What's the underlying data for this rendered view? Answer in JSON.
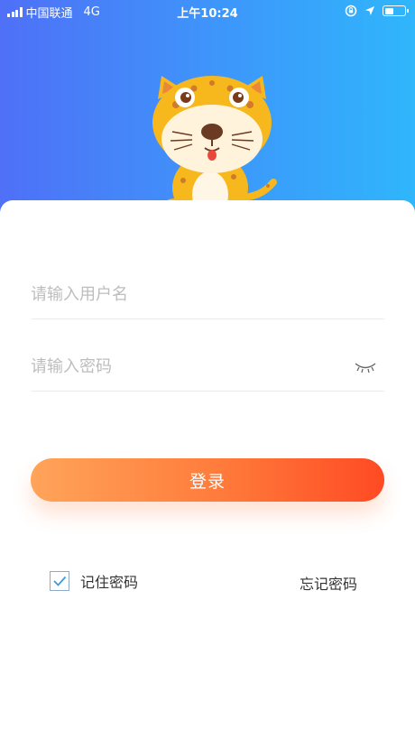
{
  "status_bar": {
    "carrier": "中国联通",
    "network": "4G",
    "time": "上午10:24",
    "battery_level": 0.45,
    "icons": [
      "signal-icon",
      "orientation-lock-icon",
      "location-icon",
      "battery-icon"
    ]
  },
  "colors": {
    "hero_gradient": [
      "#4f70f7",
      "#2fb6fb"
    ],
    "button_gradient": [
      "#ffa45a",
      "#ff4a24"
    ],
    "checkbox_check": "#3a9be0"
  },
  "mascot": {
    "icon": "leopard-mascot-icon"
  },
  "form": {
    "username_placeholder": "请输入用户名",
    "password_placeholder": "请输入密码",
    "password_toggle_icon": "eye-closed-icon",
    "login_label": "登录",
    "remember_label": "记住密码",
    "remember_checked": true,
    "forgot_label": "忘记密码"
  }
}
